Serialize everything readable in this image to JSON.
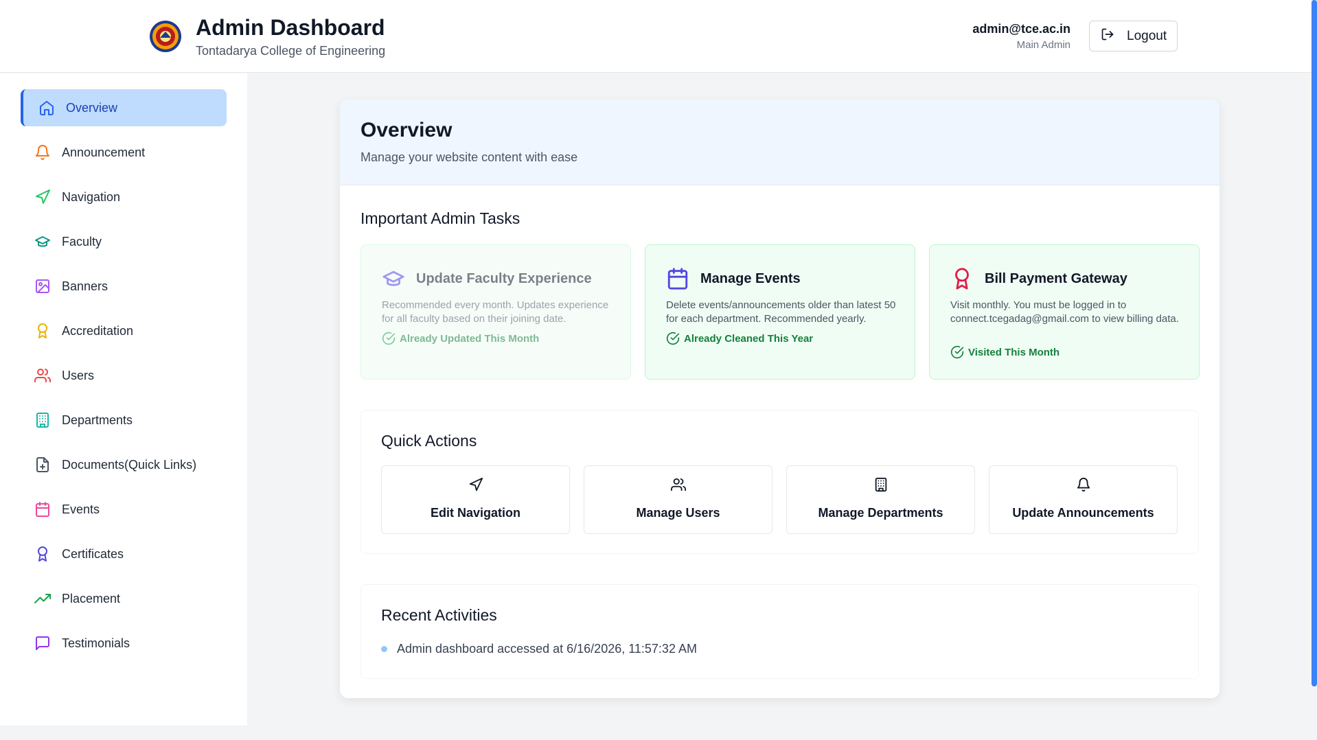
{
  "header": {
    "title": "Admin Dashboard",
    "subtitle": "Tontadarya College of Engineering",
    "user_email": "admin@tce.ac.in",
    "user_role": "Main Admin",
    "logout_label": "Logout"
  },
  "sidebar": {
    "items": [
      {
        "label": "Overview",
        "icon": "home-icon",
        "color": "#2563eb",
        "active": true
      },
      {
        "label": "Announcement",
        "icon": "bell-icon",
        "color": "#f97316"
      },
      {
        "label": "Navigation",
        "icon": "navigation-icon",
        "color": "#22c55e"
      },
      {
        "label": "Faculty",
        "icon": "graduation-cap-icon",
        "color": "#0d9488"
      },
      {
        "label": "Banners",
        "icon": "image-icon",
        "color": "#a855f7"
      },
      {
        "label": "Accreditation",
        "icon": "award-icon",
        "color": "#eab308"
      },
      {
        "label": "Users",
        "icon": "users-icon",
        "color": "#ef4444"
      },
      {
        "label": "Departments",
        "icon": "building-icon",
        "color": "#14b8a6"
      },
      {
        "label": "Documents(Quick Links)",
        "icon": "file-plus-icon",
        "color": "#4b5563"
      },
      {
        "label": "Events",
        "icon": "calendar-icon",
        "color": "#ec4899"
      },
      {
        "label": "Certificates",
        "icon": "award-icon",
        "color": "#4f46e5"
      },
      {
        "label": "Placement",
        "icon": "trending-up-icon",
        "color": "#16a34a"
      },
      {
        "label": "Testimonials",
        "icon": "message-square-icon",
        "color": "#9333ea"
      }
    ]
  },
  "overview": {
    "title": "Overview",
    "subtitle": "Manage your website content with ease"
  },
  "admin_tasks": {
    "title": "Important Admin Tasks",
    "cards": [
      {
        "title": "Update Faculty Experience",
        "icon": "graduation-cap-icon",
        "icon_color": "#4f46e5",
        "description": "Recommended every month. Updates experience for all faculty based on their joining date.",
        "status": "Already Updated This Month"
      },
      {
        "title": "Manage Events",
        "icon": "calendar-icon",
        "icon_color": "#4f46e5",
        "description": "Delete events/announcements older than latest 50 for each department. Recommended yearly.",
        "status": "Already Cleaned This Year"
      },
      {
        "title": "Bill Payment Gateway",
        "icon": "award-icon",
        "icon_color": "#e11d48",
        "description": "Visit monthly. You must be logged in to connect.tcegadag@gmail.com to view billing data.",
        "status": "Visited This Month"
      }
    ]
  },
  "quick_actions": {
    "title": "Quick Actions",
    "buttons": [
      {
        "label": "Edit Navigation",
        "icon": "navigation-icon"
      },
      {
        "label": "Manage Users",
        "icon": "users-icon"
      },
      {
        "label": "Manage Departments",
        "icon": "building-icon"
      },
      {
        "label": "Update Announcements",
        "icon": "bell-icon"
      }
    ]
  },
  "recent_activities": {
    "title": "Recent Activities",
    "items": [
      "Admin dashboard accessed at 6/16/2026, 11:57:32 AM"
    ]
  }
}
